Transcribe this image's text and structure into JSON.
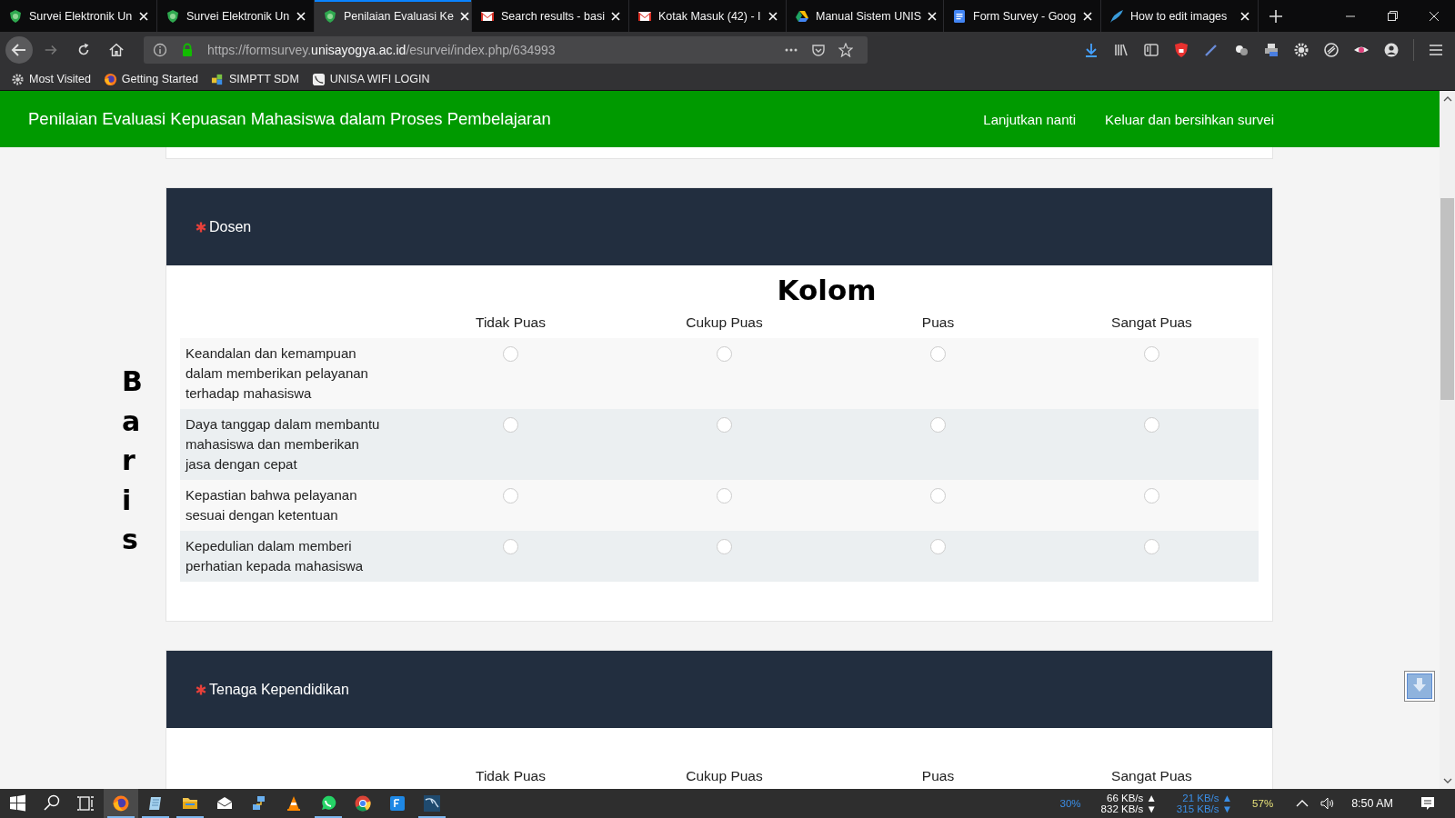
{
  "tabs": [
    {
      "title": "Survei Elektronik Un",
      "kind": "shield",
      "selected": false
    },
    {
      "title": "Survei Elektronik Un",
      "kind": "shield",
      "selected": false
    },
    {
      "title": "Penilaian Evaluasi Ke",
      "kind": "shield",
      "selected": true
    },
    {
      "title": "Search results - basi",
      "kind": "mail",
      "selected": false
    },
    {
      "title": "Kotak Masuk (42) - I",
      "kind": "mail",
      "selected": false
    },
    {
      "title": "Manual Sistem UNIS",
      "kind": "drive",
      "selected": false
    },
    {
      "title": "Form Survey - Goog",
      "kind": "doc",
      "selected": false
    },
    {
      "title": "How to edit images",
      "kind": "feather",
      "selected": false
    }
  ],
  "nav": {
    "url": {
      "scheme": "https://formsurvey.",
      "domain": "unisayogya.ac.id",
      "path": "/esurvei/index.php/634993"
    }
  },
  "bookmarks": [
    {
      "label": "Most Visited",
      "kind": "gear"
    },
    {
      "label": "Getting Started",
      "kind": "firefox"
    },
    {
      "label": "SIMPTT SDM",
      "kind": "puzzle"
    },
    {
      "label": "UNISA WIFI LOGIN",
      "kind": "wave"
    }
  ],
  "survey_header": {
    "title": "Penilaian Evaluasi Kepuasan Mahasiswa dalam Proses Pembelajaran",
    "links": [
      "Lanjutkan nanti",
      "Keluar dan bersihkan survei"
    ]
  },
  "sections": [
    {
      "title": "Dosen",
      "required": true,
      "side_label": "Baris",
      "heading": "Kolom",
      "columns": [
        "Tidak Puas",
        "Cukup Puas",
        "Puas",
        "Sangat Puas"
      ],
      "rows": [
        {
          "text": "Keandalan dan kemampuan dalam memberikan pelayanan terhadap mahasiswa",
          "options": [
            {
              "selected": false
            },
            {
              "selected": false
            },
            {
              "selected": false
            },
            {
              "selected": false
            }
          ]
        },
        {
          "text": "Daya tanggap dalam membantu mahasiswa dan memberikan jasa dengan cepat",
          "options": [
            {
              "selected": false
            },
            {
              "selected": false
            },
            {
              "selected": false
            },
            {
              "selected": false
            }
          ]
        },
        {
          "text": "Kepastian bahwa pelayanan sesuai dengan ketentuan",
          "options": [
            {
              "selected": false
            },
            {
              "selected": false
            },
            {
              "selected": false
            },
            {
              "selected": false
            }
          ]
        },
        {
          "text": "Kepedulian dalam memberi perhatian kepada mahasiswa",
          "options": [
            {
              "selected": false
            },
            {
              "selected": false
            },
            {
              "selected": false
            },
            {
              "selected": false
            }
          ]
        }
      ]
    },
    {
      "title": "Tenaga Kependidikan",
      "required": true,
      "columns": [
        "Tidak Puas",
        "Cukup Puas",
        "Puas",
        "Sangat Puas"
      ]
    }
  ],
  "taskbar": {
    "apps": [
      {
        "kind": "firefox",
        "running": true,
        "active": true
      },
      {
        "kind": "notepad",
        "running": true,
        "active": false
      },
      {
        "kind": "folder",
        "running": true,
        "active": false
      },
      {
        "kind": "mail",
        "running": false,
        "active": false
      },
      {
        "kind": "network",
        "running": false,
        "active": false
      },
      {
        "kind": "cone",
        "running": false,
        "active": false
      },
      {
        "kind": "whatsapp",
        "running": true,
        "active": false
      },
      {
        "kind": "chrome",
        "running": false,
        "active": false
      },
      {
        "kind": "fs",
        "running": false,
        "active": false
      },
      {
        "kind": "dolphin",
        "running": true,
        "active": false
      }
    ],
    "meters": [
      {
        "lines": [
          "30%"
        ],
        "color": "#3a8ee6"
      },
      {
        "lines": [
          "66 KB/s ▲",
          "832 KB/s ▼"
        ],
        "color": "#ffffff"
      },
      {
        "lines": [
          "21 KB/s ▲",
          "315 KB/s ▼"
        ],
        "color": "#3a8ee6"
      },
      {
        "lines": [
          "57%"
        ],
        "color": "#e8e27a"
      }
    ],
    "time": "8:50 AM"
  }
}
